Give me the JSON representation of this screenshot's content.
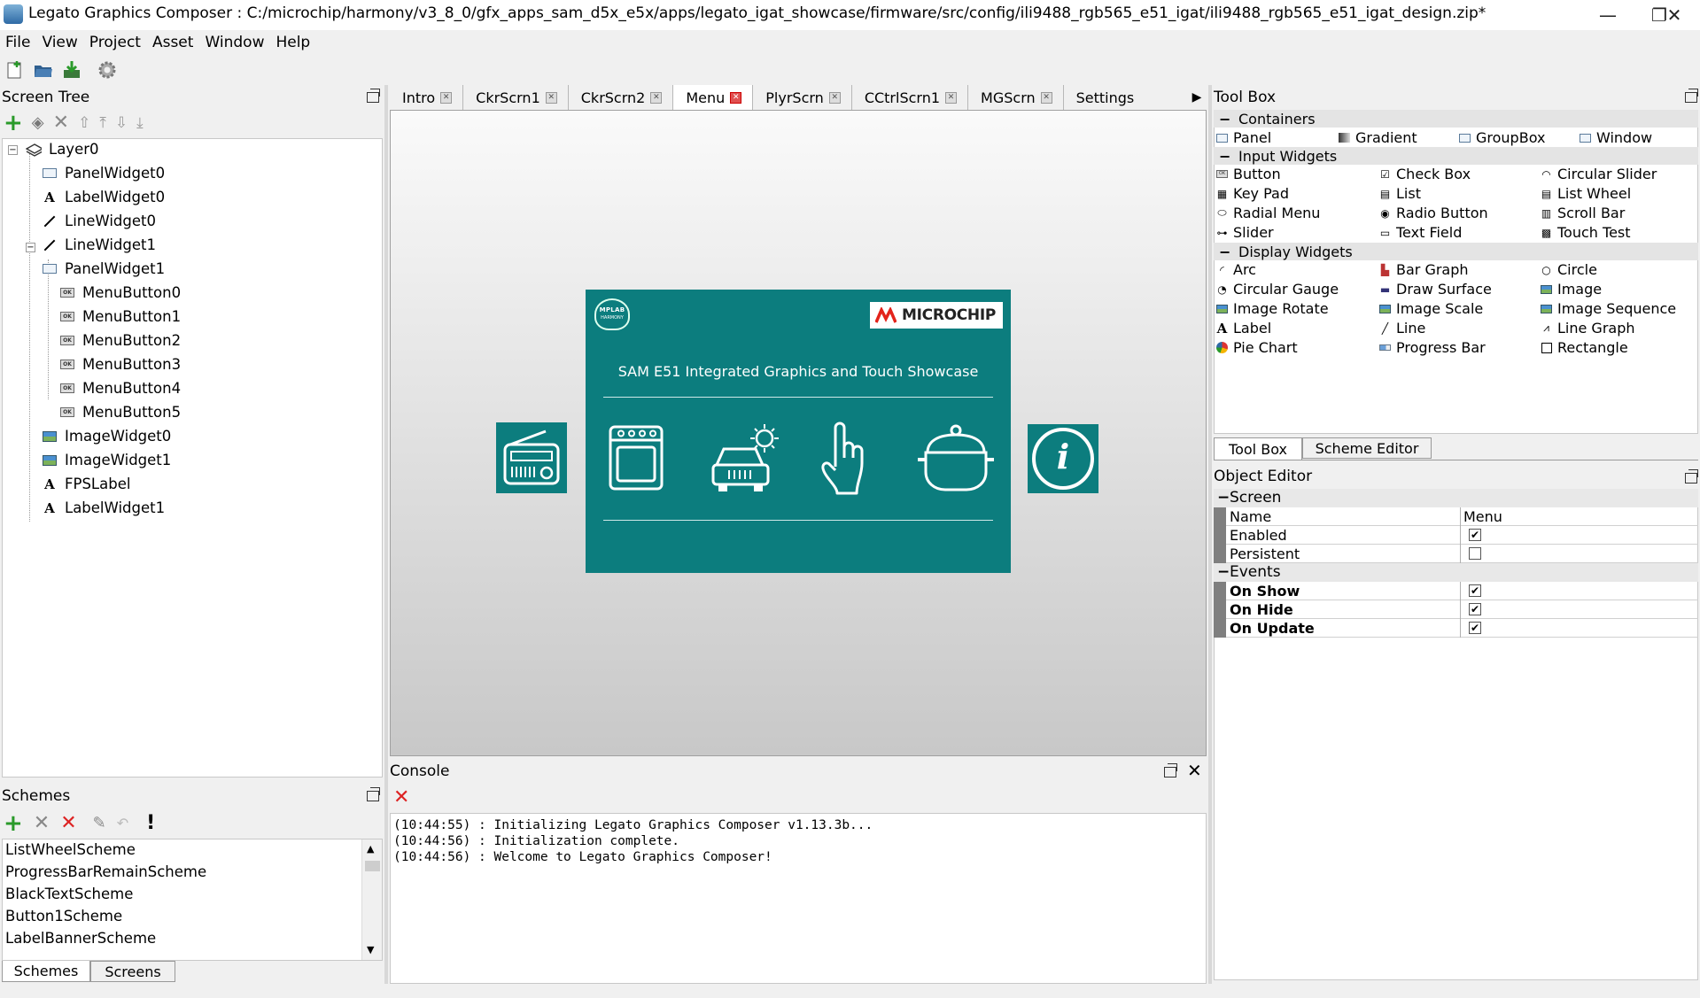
{
  "window": {
    "title": "Legato Graphics Composer : C:/microchip/harmony/v3_8_0/gfx_apps_sam_d5x_e5x/apps/legato_igat_showcase/firmware/src/config/ili9488_rgb565_e51_igat/ili9488_rgb565_e51_igat_design.zip*",
    "minimize": "—",
    "restore": "❐",
    "close": "✕"
  },
  "menu": [
    "File",
    "View",
    "Project",
    "Asset",
    "Window",
    "Help"
  ],
  "screen_tree": {
    "title": "Screen Tree",
    "items": [
      {
        "label": "Layer0",
        "icon": "layer-icon",
        "indent": 0
      },
      {
        "label": "PanelWidget0",
        "icon": "panel-icon",
        "indent": 1
      },
      {
        "label": "LabelWidget0",
        "icon": "label-icon",
        "indent": 1
      },
      {
        "label": "LineWidget0",
        "icon": "line-icon",
        "indent": 1
      },
      {
        "label": "LineWidget1",
        "icon": "line-icon",
        "indent": 1
      },
      {
        "label": "PanelWidget1",
        "icon": "panel-icon",
        "indent": 1
      },
      {
        "label": "MenuButton0",
        "icon": "button-icon",
        "indent": 2
      },
      {
        "label": "MenuButton1",
        "icon": "button-icon",
        "indent": 2
      },
      {
        "label": "MenuButton2",
        "icon": "button-icon",
        "indent": 2
      },
      {
        "label": "MenuButton3",
        "icon": "button-icon",
        "indent": 2
      },
      {
        "label": "MenuButton4",
        "icon": "button-icon",
        "indent": 2
      },
      {
        "label": "MenuButton5",
        "icon": "button-icon",
        "indent": 2
      },
      {
        "label": "ImageWidget0",
        "icon": "image-icon",
        "indent": 1
      },
      {
        "label": "ImageWidget1",
        "icon": "image-icon",
        "indent": 1
      },
      {
        "label": "FPSLabel",
        "icon": "label-icon",
        "indent": 1
      },
      {
        "label": "LabelWidget1",
        "icon": "label-icon",
        "indent": 1
      }
    ]
  },
  "schemes": {
    "title": "Schemes",
    "items": [
      "ListWheelScheme",
      "ProgressBarRemainScheme",
      "BlackTextScheme",
      "Button1Scheme",
      "LabelBannerScheme"
    ],
    "bottom_tabs": [
      "Schemes",
      "Screens"
    ]
  },
  "editor": {
    "tabs": [
      {
        "label": "Intro",
        "active": false
      },
      {
        "label": "CkrScrn1",
        "active": false
      },
      {
        "label": "CkrScrn2",
        "active": false
      },
      {
        "label": "Menu",
        "active": true
      },
      {
        "label": "PlyrScrn",
        "active": false
      },
      {
        "label": "CCtrlScrn1",
        "active": false
      },
      {
        "label": "MGScrn",
        "active": false
      },
      {
        "label": "Settings",
        "active": false
      }
    ],
    "screen": {
      "heading": "SAM E51 Integrated Graphics and Touch Showcase",
      "brand": "MICROCHIP",
      "badge_line1": "MPLAB",
      "badge_line2": "HARMONY",
      "info_glyph": "i",
      "teal": "#0c7d7e"
    }
  },
  "console": {
    "title": "Console",
    "lines": [
      "(10:44:55) : Initializing Legato Graphics Composer v1.13.3b...",
      "(10:44:56) : Initialization complete.",
      "(10:44:56) : Welcome to Legato Graphics Composer!"
    ]
  },
  "toolbox": {
    "title": "Tool Box",
    "categories": [
      {
        "name": "Containers",
        "items": [
          "Panel",
          "Gradient",
          "GroupBox",
          "Window"
        ]
      },
      {
        "name": "Input Widgets",
        "items": [
          "Button",
          "Check Box",
          "Circular Slider",
          "Key Pad",
          "List",
          "List Wheel",
          "Radial Menu",
          "Radio Button",
          "Scroll Bar",
          "Slider",
          "Text Field",
          "Touch Test"
        ]
      },
      {
        "name": "Display Widgets",
        "items": [
          "Arc",
          "Bar Graph",
          "Circle",
          "Circular Gauge",
          "Draw Surface",
          "Image",
          "Image Rotate",
          "Image Scale",
          "Image Sequence",
          "Label",
          "Line",
          "Line Graph",
          "Pie Chart",
          "Progress Bar",
          "Rectangle"
        ]
      }
    ],
    "bottom_tabs": [
      "Tool Box",
      "Scheme Editor"
    ]
  },
  "object_editor": {
    "title": "Object Editor",
    "sections": [
      {
        "name": "Screen",
        "rows": [
          {
            "label": "Name",
            "value": "Menu",
            "checkbox": null
          },
          {
            "label": "Enabled",
            "value": "",
            "checkbox": true
          },
          {
            "label": "Persistent",
            "value": "",
            "checkbox": false
          }
        ]
      },
      {
        "name": "Events",
        "rows": [
          {
            "label": "On Show",
            "value": "",
            "checkbox": true
          },
          {
            "label": "On Hide",
            "value": "",
            "checkbox": true
          },
          {
            "label": "On Update",
            "value": "",
            "checkbox": true
          }
        ]
      }
    ]
  }
}
